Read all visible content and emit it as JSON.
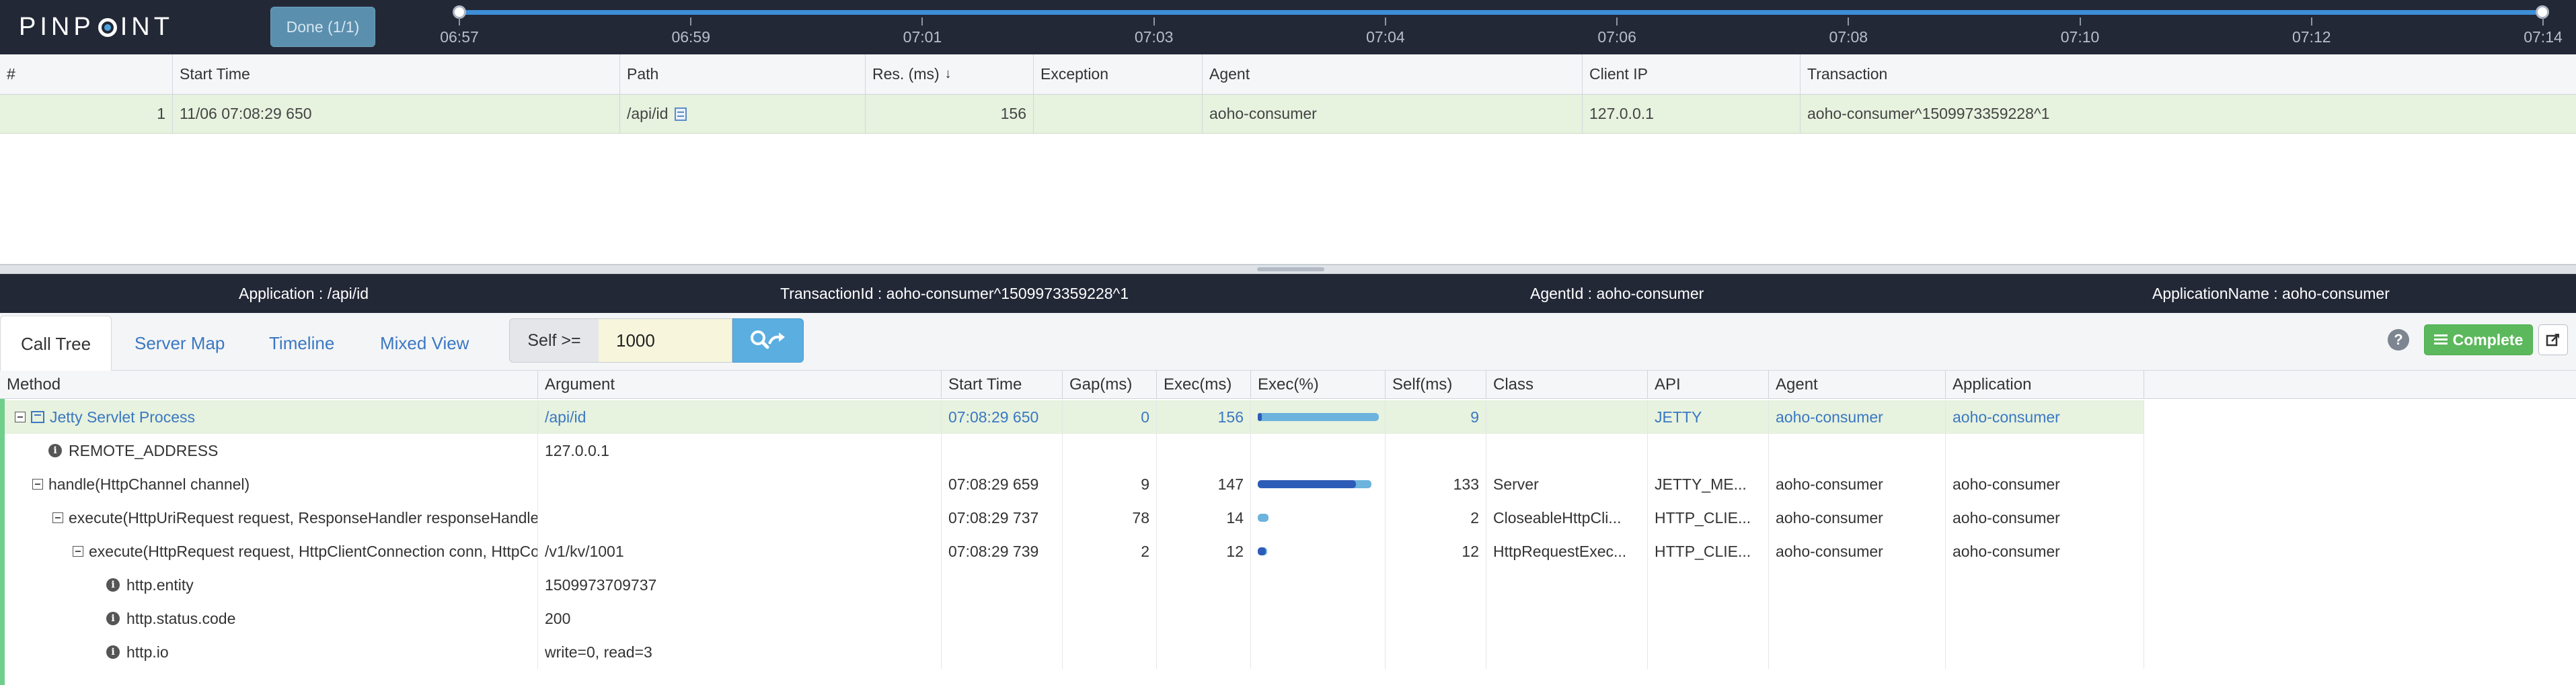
{
  "header": {
    "logo_left": "PINP",
    "logo_right": "INT",
    "done_button": "Done (1/1)",
    "timeline_labels": [
      "06:57",
      "06:59",
      "07:01",
      "07:03",
      "07:04",
      "07:06",
      "07:08",
      "07:10",
      "07:12",
      "07:14"
    ]
  },
  "transactions": {
    "columns": [
      "#",
      "Start Time",
      "Path",
      "Res. (ms)",
      "Exception",
      "Agent",
      "Client IP",
      "Transaction"
    ],
    "rows": [
      {
        "index": "1",
        "start_time": "11/06 07:08:29 650",
        "path": "/api/id",
        "res_ms": "156",
        "exception": "",
        "agent": "aoho-consumer",
        "client_ip": "127.0.0.1",
        "transaction": "aoho-consumer^1509973359228^1"
      }
    ]
  },
  "info_bar": {
    "application": "Application : /api/id",
    "transaction_id": "TransactionId : aoho-consumer^1509973359228^1",
    "agent_id": "AgentId : aoho-consumer",
    "application_name": "ApplicationName : aoho-consumer"
  },
  "tabs": {
    "items": [
      "Call Tree",
      "Server Map",
      "Timeline",
      "Mixed View"
    ],
    "active": "Call Tree",
    "filter_label": "Self >=",
    "filter_value": "1000",
    "complete_button": "Complete",
    "help": "?"
  },
  "call_tree": {
    "columns": [
      "Method",
      "Argument",
      "Start Time",
      "Gap(ms)",
      "Exec(ms)",
      "Exec(%)",
      "Self(ms)",
      "Class",
      "API",
      "Agent",
      "Application"
    ],
    "rows": [
      {
        "method": "Jetty Servlet Process",
        "argument": "/api/id",
        "start_time": "07:08:29 650",
        "gap": "0",
        "exec": "156",
        "exec_pct": 1.0,
        "self": "9",
        "class": "",
        "api": "JETTY",
        "agent": "aoho-consumer",
        "application": "aoho-consumer"
      },
      {
        "method": "REMOTE_ADDRESS",
        "argument": "127.0.0.1",
        "start_time": "",
        "gap": "",
        "exec": "",
        "exec_pct": null,
        "self": "",
        "class": "",
        "api": "",
        "agent": "",
        "application": ""
      },
      {
        "method": "handle(HttpChannel channel)",
        "argument": "",
        "start_time": "07:08:29 659",
        "gap": "9",
        "exec": "147",
        "exec_pct": 0.94,
        "self": "133",
        "class": "Server",
        "api": "JETTY_ME...",
        "agent": "aoho-consumer",
        "application": "aoho-consumer"
      },
      {
        "method": "execute(HttpUriRequest request, ResponseHandler responseHandler)",
        "argument": "",
        "start_time": "07:08:29 737",
        "gap": "78",
        "exec": "14",
        "exec_pct": 0.09,
        "self": "2",
        "class": "CloseableHttpCli...",
        "api": "HTTP_CLIE...",
        "agent": "aoho-consumer",
        "application": "aoho-consumer"
      },
      {
        "method": "execute(HttpRequest request, HttpClientConnection conn, HttpContext context)",
        "argument": "/v1/kv/1001",
        "start_time": "07:08:29 739",
        "gap": "2",
        "exec": "12",
        "exec_pct": 0.08,
        "self": "12",
        "class": "HttpRequestExec...",
        "api": "HTTP_CLIE...",
        "agent": "aoho-consumer",
        "application": "aoho-consumer"
      },
      {
        "method": "http.entity",
        "argument": "1509973709737",
        "start_time": "",
        "gap": "",
        "exec": "",
        "exec_pct": null,
        "self": "",
        "class": "",
        "api": "",
        "agent": "",
        "application": ""
      },
      {
        "method": "http.status.code",
        "argument": "200",
        "start_time": "",
        "gap": "",
        "exec": "",
        "exec_pct": null,
        "self": "",
        "class": "",
        "api": "",
        "agent": "",
        "application": ""
      },
      {
        "method": "http.io",
        "argument": "write=0, read=3",
        "start_time": "",
        "gap": "",
        "exec": "",
        "exec_pct": null,
        "self": "",
        "class": "",
        "api": "",
        "agent": "",
        "application": ""
      }
    ]
  },
  "colors": {
    "header_bg": "#232837",
    "timeline_accent": "#3d8ed6",
    "selected_row": "#e7f2df",
    "link_blue": "#3a78c2",
    "complete_green": "#5cb85c"
  }
}
